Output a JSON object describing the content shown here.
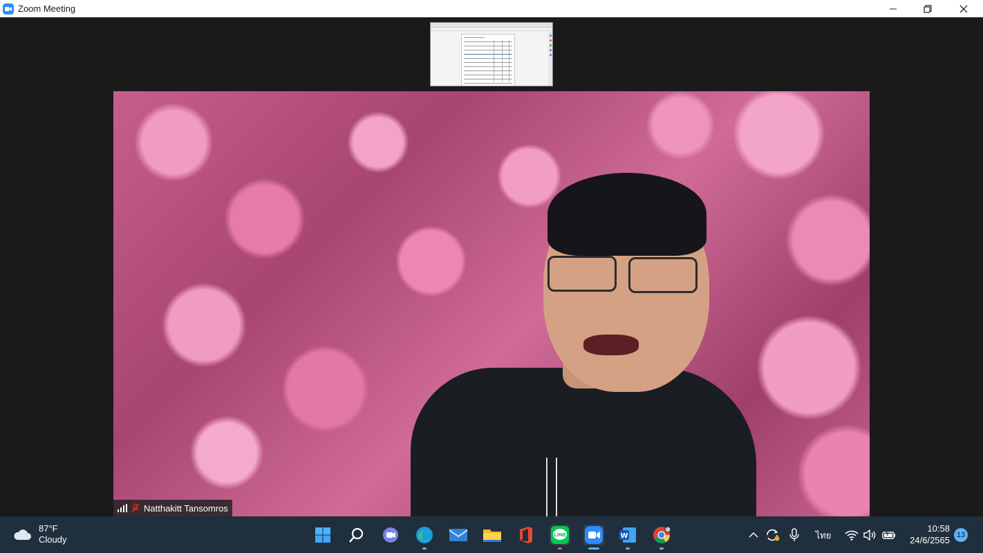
{
  "window": {
    "title": "Zoom Meeting",
    "controls": {
      "minimize": "—",
      "maximize": "❐",
      "close": "✕"
    }
  },
  "meeting": {
    "participant_name": "Natthakitt Tansomros",
    "mic_muted": true,
    "shared_screen_thumbnail": true
  },
  "taskbar": {
    "weather": {
      "temp": "87°F",
      "condition": "Cloudy",
      "icon": "cloud-icon"
    },
    "apps": [
      {
        "name": "start",
        "icon": "windows-start-icon"
      },
      {
        "name": "search",
        "icon": "search-icon"
      },
      {
        "name": "teams-chat",
        "icon": "chat-icon"
      },
      {
        "name": "edge",
        "icon": "edge-icon"
      },
      {
        "name": "mail",
        "icon": "mail-icon"
      },
      {
        "name": "file-explorer",
        "icon": "folder-icon"
      },
      {
        "name": "office",
        "icon": "office-icon"
      },
      {
        "name": "line",
        "icon": "line-icon",
        "label": "LINE"
      },
      {
        "name": "zoom",
        "icon": "zoom-icon"
      },
      {
        "name": "word",
        "icon": "word-icon",
        "label": "W"
      },
      {
        "name": "chrome",
        "icon": "chrome-icon"
      }
    ],
    "tray": {
      "input_language": "ไทย"
    },
    "clock": {
      "time": "10:58",
      "date": "24/6/2565"
    },
    "notification_count": "13"
  },
  "colors": {
    "taskbar_bg": "#1f2f3d",
    "zoom_blue": "#2d8cff",
    "line_green": "#06c755",
    "accent_blue": "#5fb2ff"
  }
}
